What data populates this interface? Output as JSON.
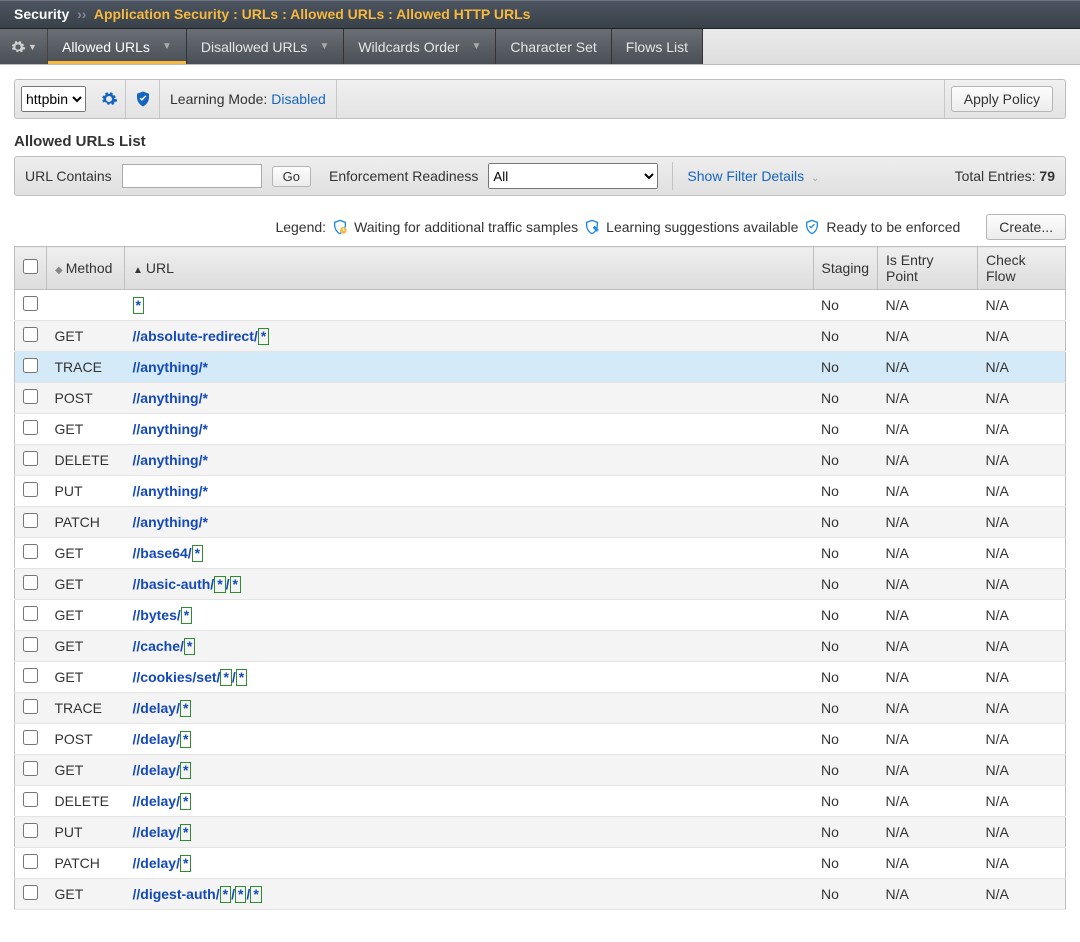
{
  "breadcrumb": {
    "root": "Security",
    "path": "Application Security : URLs : Allowed URLs : Allowed HTTP URLs"
  },
  "tabs": [
    {
      "label": "Allowed URLs",
      "dropdown": true,
      "active": true
    },
    {
      "label": "Disallowed URLs",
      "dropdown": true,
      "active": false
    },
    {
      "label": "Wildcards Order",
      "dropdown": true,
      "active": false
    },
    {
      "label": "Character Set",
      "dropdown": false,
      "active": false
    },
    {
      "label": "Flows List",
      "dropdown": false,
      "active": false
    }
  ],
  "policy": {
    "selected": "httpbin",
    "learning_label": "Learning Mode:",
    "learning_value": "Disabled",
    "apply_label": "Apply Policy"
  },
  "section_title": "Allowed URLs List",
  "filter": {
    "url_contains_label": "URL Contains",
    "url_contains_value": "",
    "go_label": "Go",
    "enforcement_label": "Enforcement Readiness",
    "enforcement_value": "All",
    "show_details": "Show Filter Details",
    "total_label": "Total Entries:",
    "total_value": "79"
  },
  "legend": {
    "prefix": "Legend:",
    "waiting": "Waiting for additional traffic samples",
    "suggestions": "Learning suggestions available",
    "ready": "Ready to be enforced",
    "create": "Create..."
  },
  "columns": {
    "method": "Method",
    "url": "URL",
    "staging": "Staging",
    "entry": "Is Entry Point",
    "flow": "Check Flow"
  },
  "rows": [
    {
      "method": "",
      "url": [
        {
          "t": "wild",
          "v": "*"
        }
      ],
      "staging": "No",
      "entry": "N/A",
      "flow": "N/A",
      "hl": false
    },
    {
      "method": "GET",
      "url": [
        {
          "t": "txt",
          "v": "//absolute-redirect/"
        },
        {
          "t": "wild",
          "v": "*"
        }
      ],
      "staging": "No",
      "entry": "N/A",
      "flow": "N/A",
      "hl": false
    },
    {
      "method": "TRACE",
      "url": [
        {
          "t": "txt",
          "v": "//anything/*"
        }
      ],
      "staging": "No",
      "entry": "N/A",
      "flow": "N/A",
      "hl": true
    },
    {
      "method": "POST",
      "url": [
        {
          "t": "txt",
          "v": "//anything/*"
        }
      ],
      "staging": "No",
      "entry": "N/A",
      "flow": "N/A",
      "hl": false
    },
    {
      "method": "GET",
      "url": [
        {
          "t": "txt",
          "v": "//anything/*"
        }
      ],
      "staging": "No",
      "entry": "N/A",
      "flow": "N/A",
      "hl": false
    },
    {
      "method": "DELETE",
      "url": [
        {
          "t": "txt",
          "v": "//anything/*"
        }
      ],
      "staging": "No",
      "entry": "N/A",
      "flow": "N/A",
      "hl": false
    },
    {
      "method": "PUT",
      "url": [
        {
          "t": "txt",
          "v": "//anything/*"
        }
      ],
      "staging": "No",
      "entry": "N/A",
      "flow": "N/A",
      "hl": false
    },
    {
      "method": "PATCH",
      "url": [
        {
          "t": "txt",
          "v": "//anything/*"
        }
      ],
      "staging": "No",
      "entry": "N/A",
      "flow": "N/A",
      "hl": false
    },
    {
      "method": "GET",
      "url": [
        {
          "t": "txt",
          "v": "//base64/"
        },
        {
          "t": "wild",
          "v": "*"
        }
      ],
      "staging": "No",
      "entry": "N/A",
      "flow": "N/A",
      "hl": false
    },
    {
      "method": "GET",
      "url": [
        {
          "t": "txt",
          "v": "//basic-auth/"
        },
        {
          "t": "wild",
          "v": "*"
        },
        {
          "t": "txt",
          "v": "/"
        },
        {
          "t": "wild",
          "v": "*"
        }
      ],
      "staging": "No",
      "entry": "N/A",
      "flow": "N/A",
      "hl": false
    },
    {
      "method": "GET",
      "url": [
        {
          "t": "txt",
          "v": "//bytes/"
        },
        {
          "t": "wild",
          "v": "*"
        }
      ],
      "staging": "No",
      "entry": "N/A",
      "flow": "N/A",
      "hl": false
    },
    {
      "method": "GET",
      "url": [
        {
          "t": "txt",
          "v": "//cache/"
        },
        {
          "t": "wild",
          "v": "*"
        }
      ],
      "staging": "No",
      "entry": "N/A",
      "flow": "N/A",
      "hl": false
    },
    {
      "method": "GET",
      "url": [
        {
          "t": "txt",
          "v": "//cookies/set/"
        },
        {
          "t": "wild",
          "v": "*"
        },
        {
          "t": "txt",
          "v": "/"
        },
        {
          "t": "wild",
          "v": "*"
        }
      ],
      "staging": "No",
      "entry": "N/A",
      "flow": "N/A",
      "hl": false
    },
    {
      "method": "TRACE",
      "url": [
        {
          "t": "txt",
          "v": "//delay/"
        },
        {
          "t": "wild",
          "v": "*"
        }
      ],
      "staging": "No",
      "entry": "N/A",
      "flow": "N/A",
      "hl": false
    },
    {
      "method": "POST",
      "url": [
        {
          "t": "txt",
          "v": "//delay/"
        },
        {
          "t": "wild",
          "v": "*"
        }
      ],
      "staging": "No",
      "entry": "N/A",
      "flow": "N/A",
      "hl": false
    },
    {
      "method": "GET",
      "url": [
        {
          "t": "txt",
          "v": "//delay/"
        },
        {
          "t": "wild",
          "v": "*"
        }
      ],
      "staging": "No",
      "entry": "N/A",
      "flow": "N/A",
      "hl": false
    },
    {
      "method": "DELETE",
      "url": [
        {
          "t": "txt",
          "v": "//delay/"
        },
        {
          "t": "wild",
          "v": "*"
        }
      ],
      "staging": "No",
      "entry": "N/A",
      "flow": "N/A",
      "hl": false
    },
    {
      "method": "PUT",
      "url": [
        {
          "t": "txt",
          "v": "//delay/"
        },
        {
          "t": "wild",
          "v": "*"
        }
      ],
      "staging": "No",
      "entry": "N/A",
      "flow": "N/A",
      "hl": false
    },
    {
      "method": "PATCH",
      "url": [
        {
          "t": "txt",
          "v": "//delay/"
        },
        {
          "t": "wild",
          "v": "*"
        }
      ],
      "staging": "No",
      "entry": "N/A",
      "flow": "N/A",
      "hl": false
    },
    {
      "method": "GET",
      "url": [
        {
          "t": "txt",
          "v": "//digest-auth/"
        },
        {
          "t": "wild",
          "v": "*"
        },
        {
          "t": "txt",
          "v": "/"
        },
        {
          "t": "wild",
          "v": "*"
        },
        {
          "t": "txt",
          "v": "/"
        },
        {
          "t": "wild",
          "v": "*"
        }
      ],
      "staging": "No",
      "entry": "N/A",
      "flow": "N/A",
      "hl": false
    }
  ]
}
